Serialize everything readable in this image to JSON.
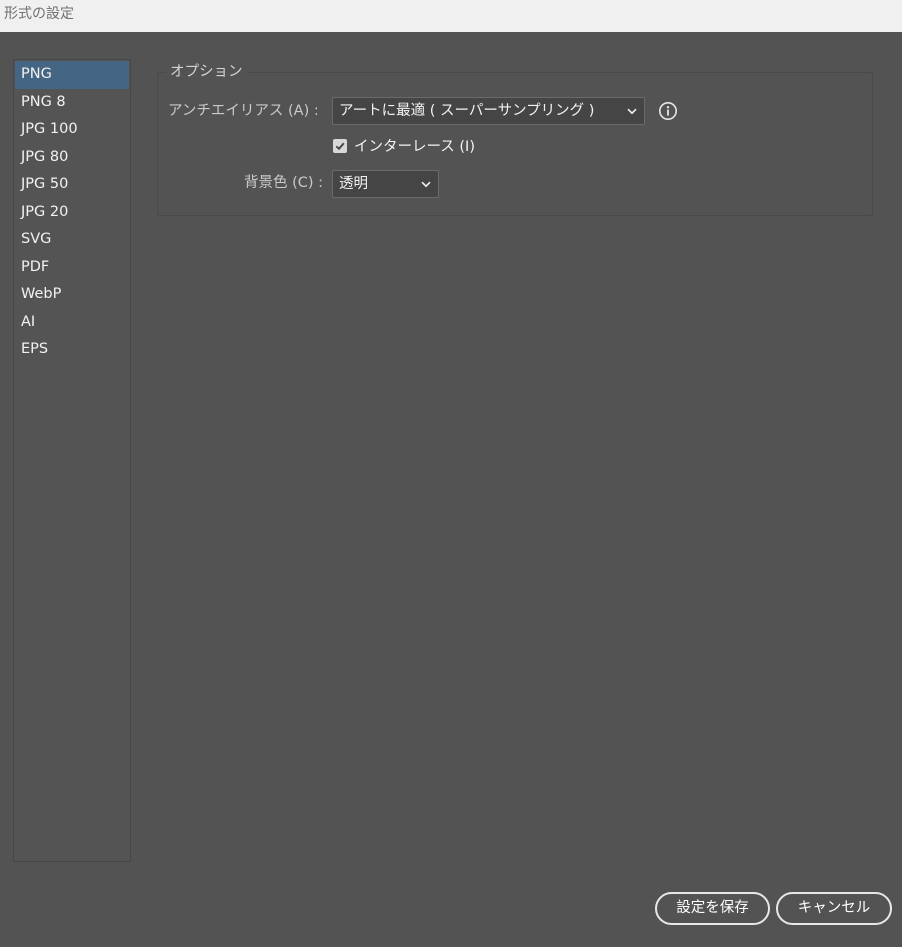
{
  "window": {
    "title": "形式の設定"
  },
  "formats": [
    {
      "label": "PNG",
      "selected": true
    },
    {
      "label": "PNG 8"
    },
    {
      "label": "JPG 100"
    },
    {
      "label": "JPG 80"
    },
    {
      "label": "JPG 50"
    },
    {
      "label": "JPG 20"
    },
    {
      "label": "SVG"
    },
    {
      "label": "PDF"
    },
    {
      "label": "WebP"
    },
    {
      "label": "AI"
    },
    {
      "label": "EPS"
    }
  ],
  "options": {
    "group_title": "オプション",
    "antialias_label": "アンチエイリアス (A) :",
    "antialias_value": "アートに最適 ( スーパーサンプリング )",
    "interlace_label": "インターレース (I)",
    "interlace_checked": true,
    "background_label": "背景色 (C) :",
    "background_value": "透明"
  },
  "buttons": {
    "save": "設定を保存",
    "cancel": "キャンセル"
  },
  "colors": {
    "background": "#535353",
    "selection": "#456584"
  }
}
